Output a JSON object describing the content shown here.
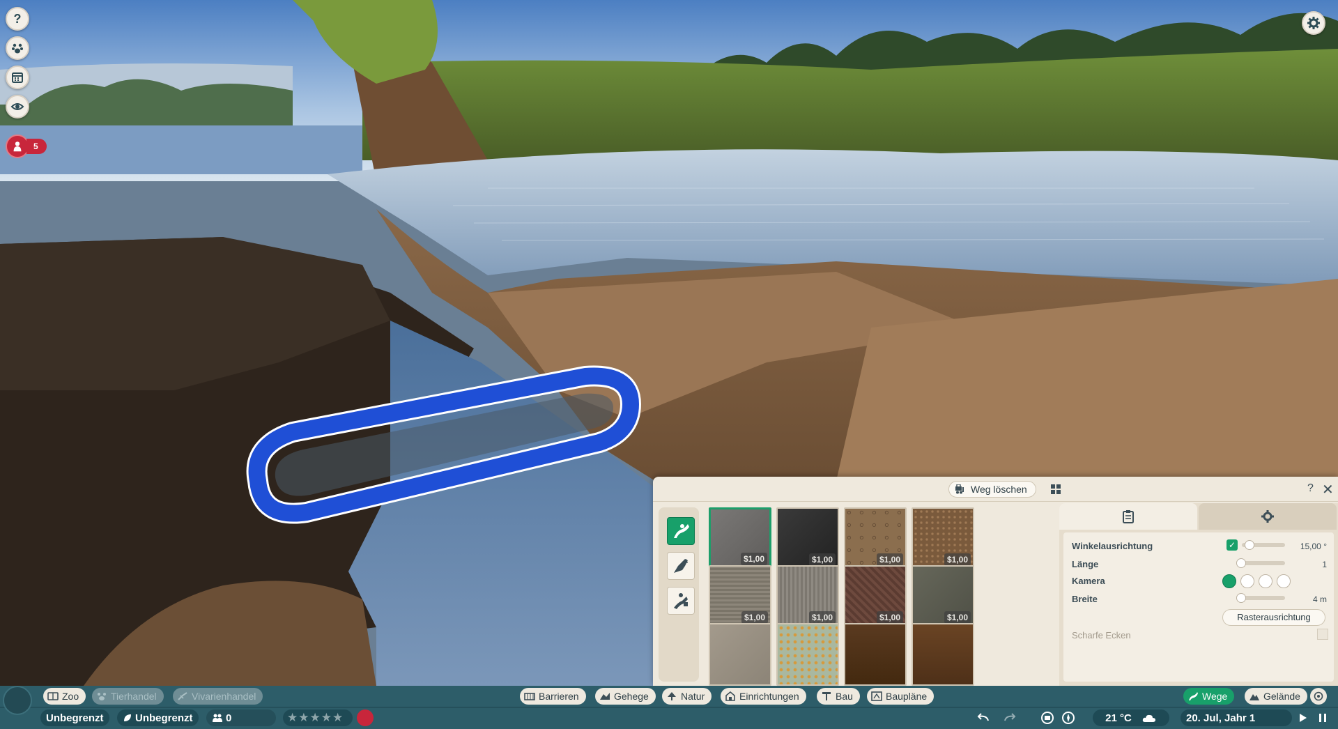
{
  "left_toolbar": {
    "help_label": "?",
    "alert_count": "5",
    "icons": [
      "question-icon",
      "animal-paw-icon",
      "calendar-icon",
      "eye-icon",
      "guest-icon"
    ]
  },
  "panel": {
    "delete_path_label": "Weg löschen",
    "help_label": "?",
    "close_label": "✕",
    "categories": [
      "path-icon",
      "animal-path-icon",
      "staff-path-icon"
    ],
    "swatches": [
      {
        "price": "$1,00",
        "texture": "gray-asphalt"
      },
      {
        "price": "$1,00",
        "texture": "dark-asphalt"
      },
      {
        "price": "$1,00",
        "texture": "cobblestone"
      },
      {
        "price": "$1,00",
        "texture": "brown-gravel"
      },
      {
        "price": "$1,00",
        "texture": "striated-concrete"
      },
      {
        "price": "$1,00",
        "texture": "gray-wood"
      },
      {
        "price": "$1,00",
        "texture": "red-brick"
      },
      {
        "price": "$1,00",
        "texture": "mossy-stone"
      },
      {
        "price": "",
        "texture": "flagstone"
      },
      {
        "price": "",
        "texture": "mosaic"
      },
      {
        "price": "",
        "texture": "dark-wood"
      },
      {
        "price": "",
        "texture": "brown-wood"
      }
    ],
    "options": {
      "angle_label": "Winkelausrichtung",
      "angle_value": "15,00 °",
      "length_label": "Länge",
      "length_value": "1",
      "camera_label": "Kamera",
      "width_label": "Breite",
      "width_value": "4 m",
      "grid_align_label": "Rasterausrichtung",
      "sharp_corners_label": "Scharfe Ecken"
    }
  },
  "bottom_bar": {
    "zoo": "Zoo",
    "animal_trade": "Tierhandel",
    "vivarium_trade": "Vivarienhandel",
    "barriers": "Barrieren",
    "habitats": "Gehege",
    "nature": "Natur",
    "facilities": "Einrichtungen",
    "construction": "Bau",
    "blueprints": "Baupläne",
    "paths": "Wege",
    "terrain": "Gelände",
    "money": "Unbegrenzt",
    "research": "Unbegrenzt",
    "guests": "0",
    "temperature": "21 °C",
    "date": "20. Jul, Jahr 1"
  },
  "colors": {
    "accent_green": "#18a06a",
    "bar_teal": "#2d5d69",
    "alert_red": "#c8263b",
    "path_blue": "#1f4fd6"
  }
}
